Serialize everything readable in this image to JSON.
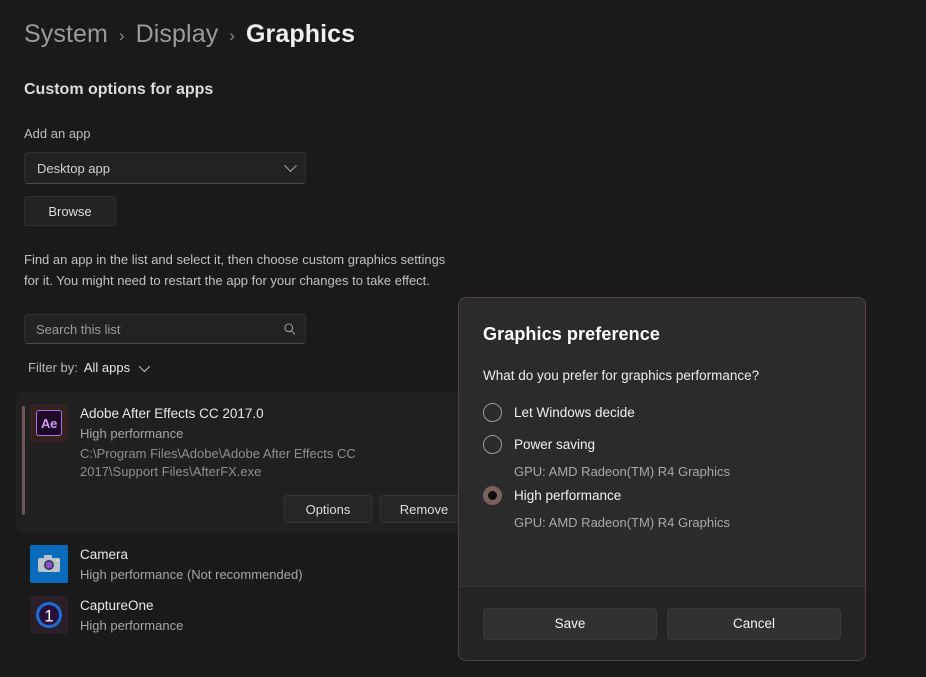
{
  "breadcrumb": {
    "items": [
      {
        "label": "System",
        "current": false
      },
      {
        "label": "Display",
        "current": false
      },
      {
        "label": "Graphics",
        "current": true
      }
    ],
    "separator": "›"
  },
  "section": {
    "title": "Custom options for apps",
    "add_app_label": "Add an app",
    "app_type_value": "Desktop app",
    "browse_label": "Browse",
    "description": "Find an app in the list and select it, then choose custom graphics settings for it. You might need to restart the app for your changes to take effect."
  },
  "search": {
    "placeholder": "Search this list",
    "icon": "search-icon"
  },
  "filter": {
    "label": "Filter by:",
    "value": "All apps",
    "icon": "chevron-down-icon"
  },
  "app_list": [
    {
      "name": "Adobe After Effects CC 2017.0",
      "status": "High performance",
      "path": "C:\\Program Files\\Adobe\\Adobe After Effects CC 2017\\Support Files\\AfterFX.exe",
      "icon": "after-effects-icon",
      "icon_text": "Ae",
      "expanded": true,
      "options_label": "Options",
      "remove_label": "Remove"
    },
    {
      "name": "Camera",
      "status": "High performance (Not recommended)",
      "icon": "camera-icon",
      "expanded": false
    },
    {
      "name": "CaptureOne",
      "status": "High performance",
      "icon": "captureone-icon",
      "icon_text": "1",
      "expanded": false
    }
  ],
  "dialog": {
    "title": "Graphics preference",
    "question": "What do you prefer for graphics performance?",
    "options": [
      {
        "label": "Let Windows decide",
        "gpu": "",
        "selected": false
      },
      {
        "label": "Power saving",
        "gpu": "GPU: AMD Radeon(TM) R4 Graphics",
        "selected": false
      },
      {
        "label": "High performance",
        "gpu": "GPU: AMD Radeon(TM) R4 Graphics",
        "selected": true
      }
    ],
    "save_label": "Save",
    "cancel_label": "Cancel"
  },
  "colors": {
    "page_background": "#1a1a1a",
    "dialog_background": "#2b2b2b",
    "dialog_border": "#53413e",
    "accent_bar": "#6e5753",
    "radio_selected": "#7a615c",
    "camera_tile": "#0a6bbd",
    "after_effects_purple": "#cf9bf5"
  }
}
